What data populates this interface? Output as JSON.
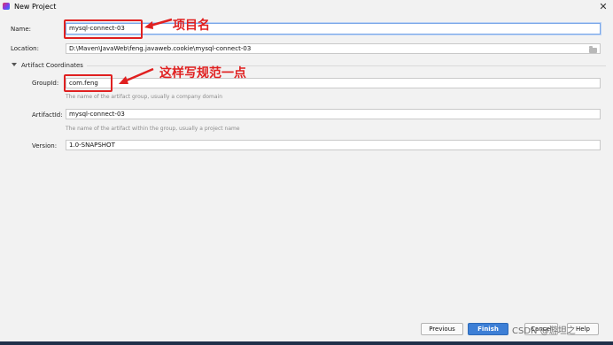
{
  "window": {
    "title": "New Project"
  },
  "form": {
    "name": {
      "label": "Name:",
      "value": "mysql-connect-03"
    },
    "location": {
      "label": "Location:",
      "value": "D:\\Maven\\JavaWeb\\feng.javaweb.cookie\\mysql-connect-03"
    },
    "artifact_section": {
      "title": "Artifact Coordinates"
    },
    "group_id": {
      "label": "GroupId:",
      "value": "com.feng",
      "hint": "The name of the artifact group, usually a company domain"
    },
    "artifact_id": {
      "label": "ArtifactId:",
      "value": "mysql-connect-03",
      "hint": "The name of the artifact within the group, usually a project name"
    },
    "version": {
      "label": "Version:",
      "value": "1.0-SNAPSHOT"
    }
  },
  "annotations": {
    "name_note": "项目名",
    "group_note": "这样写规范一点",
    "color": "#e02020"
  },
  "buttons": {
    "previous": "Previous",
    "finish": "Finish",
    "cancel": "Cancel",
    "help": "Help"
  },
  "watermark": "CSDN @游坦之",
  "icons": [
    "app-icon",
    "close-icon",
    "folder-icon",
    "expand-triangle-icon",
    "arrow-icon"
  ]
}
